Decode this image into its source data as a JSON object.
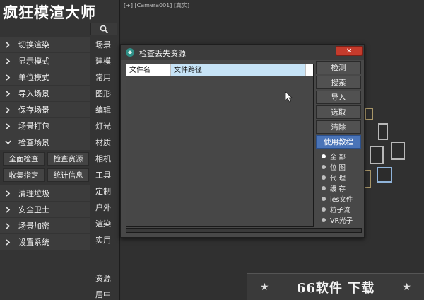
{
  "app": {
    "title": "疯狂模渲大师"
  },
  "menu": {
    "items": [
      {
        "label": "切换渲染"
      },
      {
        "label": "显示模式"
      },
      {
        "label": "单位模式"
      },
      {
        "label": "导入场景"
      },
      {
        "label": "保存场景"
      },
      {
        "label": "场景打包"
      },
      {
        "label": "检查场景",
        "expanded": true
      }
    ],
    "sub_actions": [
      "全面检查",
      "检查资源",
      "收集指定",
      "统计信息"
    ],
    "items_after": [
      {
        "label": "清理垃圾"
      },
      {
        "label": "安全卫士"
      },
      {
        "label": "场景加密"
      },
      {
        "label": "设置系统"
      }
    ]
  },
  "side_links": [
    "场景",
    "建模",
    "常用",
    "图形",
    "编辑",
    "灯光",
    "材质",
    "相机",
    "工具",
    "定制",
    "户外",
    "渲染",
    "实用"
  ],
  "side_links_bottom": [
    "资源",
    "居中"
  ],
  "viewport": {
    "label": "[+] [Camera001] [真实]"
  },
  "dialog": {
    "title": "检查丢失资源",
    "close_symbol": "✕",
    "columns": [
      "文件名",
      "文件路径"
    ],
    "buttons": [
      "检测",
      "搜索",
      "导入",
      "选取",
      "清除"
    ],
    "tutorial_button": "使用教程",
    "filters": [
      {
        "label": "全 部",
        "selected": true
      },
      {
        "label": "位 图",
        "selected": false
      },
      {
        "label": "代 理",
        "selected": false
      },
      {
        "label": "缓 存",
        "selected": false
      },
      {
        "label": "ies文件",
        "selected": false
      },
      {
        "label": "粒子流",
        "selected": false
      },
      {
        "label": "VR光子",
        "selected": false
      }
    ]
  },
  "watermark": {
    "text": "66软件 下载",
    "star": "★"
  },
  "colors": {
    "accent_blue": "#4a74b8",
    "close_red": "#c53b2c",
    "header_highlight": "#c7e4f7"
  }
}
